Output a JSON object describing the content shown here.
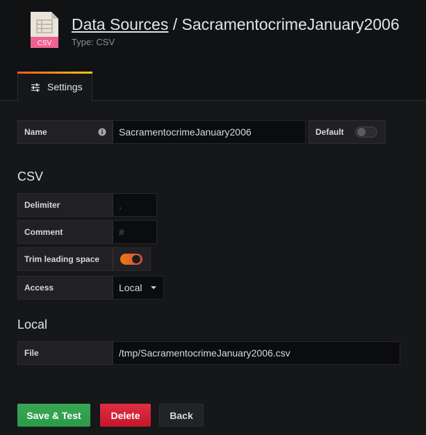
{
  "header": {
    "logo_text": "CSV",
    "breadcrumb_link": "Data Sources",
    "separator": " / ",
    "datasource_name": "SacramentocrimeJanuary2006",
    "subtitle": "Type: CSV"
  },
  "tabs": [
    {
      "label": "Settings",
      "icon": "sliders-icon",
      "active": true
    }
  ],
  "accent_gradient": [
    "#f05a28",
    "#fbca0a"
  ],
  "form": {
    "name_label": "Name",
    "name_value": "SacramentocrimeJanuary2006",
    "default_label": "Default",
    "default_on": false,
    "csv_section_title": "CSV",
    "delimiter_label": "Delimiter",
    "delimiter_placeholder": ",",
    "comment_label": "Comment",
    "comment_placeholder": "#",
    "trim_label": "Trim leading space",
    "trim_on": true,
    "access_label": "Access",
    "access_value": "Local",
    "local_section_title": "Local",
    "file_label": "File",
    "file_value": "/tmp/SacramentocrimeJanuary2006.csv"
  },
  "buttons": {
    "save_label": "Save & Test",
    "delete_label": "Delete",
    "back_label": "Back"
  },
  "colors": {
    "save": "#299c46",
    "delete": "#c4162a",
    "toggle_on": "#eb7b18",
    "background": "#161719"
  }
}
